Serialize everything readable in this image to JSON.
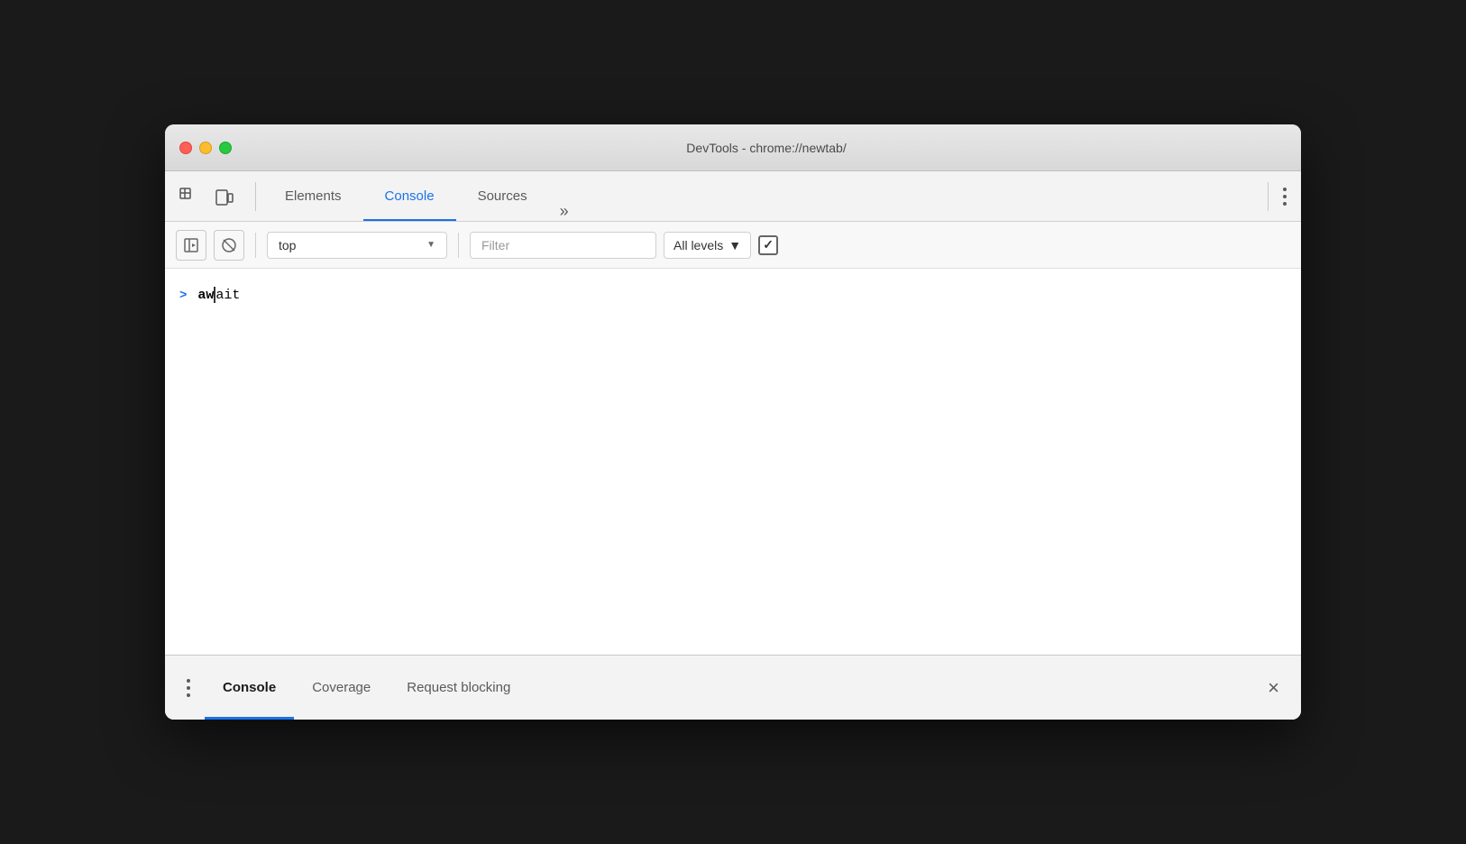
{
  "window": {
    "title": "DevTools - chrome://newtab/"
  },
  "traffic_lights": {
    "close_label": "close",
    "minimize_label": "minimize",
    "maximize_label": "maximize"
  },
  "top_toolbar": {
    "tabs": [
      {
        "id": "elements",
        "label": "Elements",
        "active": false
      },
      {
        "id": "console",
        "label": "Console",
        "active": true
      },
      {
        "id": "sources",
        "label": "Sources",
        "active": false
      }
    ],
    "more_label": "»",
    "menu_label": "⋮"
  },
  "console_toolbar": {
    "context_selector": {
      "value": "top",
      "placeholder": "top"
    },
    "filter": {
      "placeholder": "Filter",
      "value": ""
    },
    "levels": {
      "label": "All levels",
      "arrow": "▼"
    }
  },
  "console_content": {
    "entry": {
      "chevron": ">",
      "text_bold": "aw",
      "text_normal": "ait"
    }
  },
  "bottom_drawer": {
    "tabs": [
      {
        "id": "console",
        "label": "Console",
        "active": true
      },
      {
        "id": "coverage",
        "label": "Coverage",
        "active": false
      },
      {
        "id": "request-blocking",
        "label": "Request blocking",
        "active": false
      }
    ],
    "close_label": "×"
  }
}
